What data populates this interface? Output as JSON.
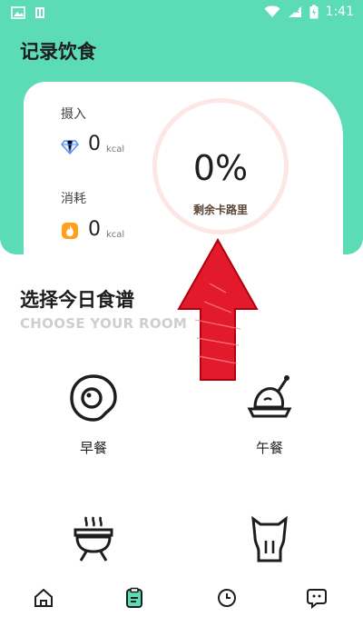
{
  "status_bar": {
    "time": "1:41"
  },
  "app": {
    "title": "记录饮食"
  },
  "summary": {
    "intake_label": "摄入",
    "intake_value": "0",
    "intake_unit": "kcal",
    "burn_label": "消耗",
    "burn_value": "0",
    "burn_unit": "kcal",
    "percent": "0%",
    "remaining_label": "剩余卡路里"
  },
  "section": {
    "title": "选择今日食谱",
    "subtitle": "CHOOSE YOUR ROOM"
  },
  "meals": [
    {
      "label": "早餐",
      "icon": "egg-icon"
    },
    {
      "label": "午餐",
      "icon": "roast-chicken-icon"
    },
    {
      "label": "",
      "icon": "grill-icon"
    },
    {
      "label": "",
      "icon": "cat-icon"
    }
  ],
  "tabs": [
    {
      "label": "",
      "icon": "home-icon"
    },
    {
      "label": "",
      "icon": "clipboard-icon"
    },
    {
      "label": "",
      "icon": "clock-icon"
    },
    {
      "label": "",
      "icon": "chat-icon"
    }
  ],
  "colors": {
    "accent": "#5bdcb6",
    "ring": "#fde6e6",
    "arrow": "#e3192c"
  }
}
